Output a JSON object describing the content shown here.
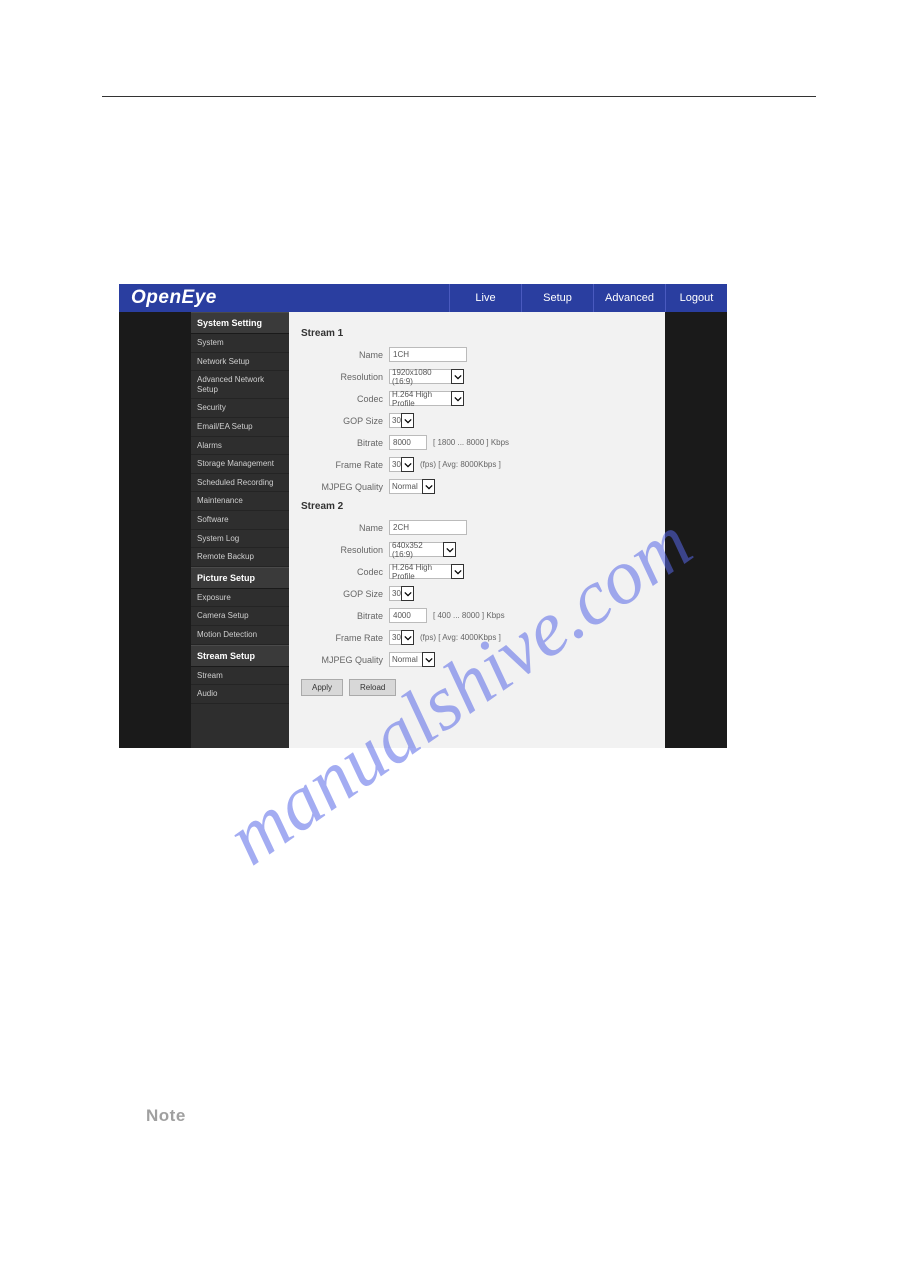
{
  "brand": "OpenEye",
  "top_nav": {
    "live": "Live",
    "setup": "Setup",
    "advanced": "Advanced",
    "logout": "Logout"
  },
  "sidebar": {
    "system_setting_header": "System Setting",
    "system": "System",
    "network_setup": "Network Setup",
    "advanced_network_setup": "Advanced Network Setup",
    "security": "Security",
    "email_ea_setup": "Email/EA Setup",
    "alarms": "Alarms",
    "storage_management": "Storage Management",
    "scheduled_recording": "Scheduled Recording",
    "maintenance": "Maintenance",
    "software": "Software",
    "system_log": "System Log",
    "remote_backup": "Remote Backup",
    "picture_setup_header": "Picture Setup",
    "exposure": "Exposure",
    "camera_setup": "Camera Setup",
    "motion_detection": "Motion Detection",
    "stream_setup_header": "Stream Setup",
    "stream": "Stream",
    "audio": "Audio"
  },
  "labels": {
    "name": "Name",
    "resolution": "Resolution",
    "codec": "Codec",
    "gop_size": "GOP Size",
    "bitrate": "Bitrate",
    "frame_rate": "Frame Rate",
    "mjpeg_quality": "MJPEG Quality"
  },
  "stream1": {
    "title": "Stream 1",
    "name": "1CH",
    "resolution": "1920x1080 (16:9)",
    "codec": "H.264 High Profile",
    "gop_size": "30",
    "bitrate": "8000",
    "bitrate_hint": "[ 1800 ... 8000 ] Kbps",
    "frame_rate": "30",
    "frame_rate_hint": "(fps) [ Avg: 8000Kbps ]",
    "mjpeg_quality": "Normal"
  },
  "stream2": {
    "title": "Stream 2",
    "name": "2CH",
    "resolution": "640x352 (16:9)",
    "codec": "H.264 High Profile",
    "gop_size": "30",
    "bitrate": "4000",
    "bitrate_hint": "[ 400 ... 8000 ] Kbps",
    "frame_rate": "30",
    "frame_rate_hint": "(fps) [ Avg: 4000Kbps ]",
    "mjpeg_quality": "Normal"
  },
  "buttons": {
    "apply": "Apply",
    "reload": "Reload"
  },
  "note_label": "Note",
  "watermark": "manualshive.com"
}
